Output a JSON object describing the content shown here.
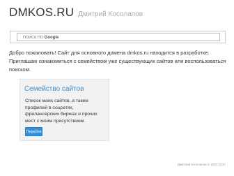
{
  "header": {
    "logo": "DMKOS.RU",
    "author": "Дмитрий Косолапов"
  },
  "search": {
    "placeholder": "Поиск: Google",
    "label_prefix": "ПОИСК ПО",
    "brand": "Google"
  },
  "intro": {
    "text": "Добро пожаловать! Сайт для основного домена dmkos.ru находится в разработке. Приглашаю ознакомиться с семейством уже существующих сайтов или воспользоваться поиском."
  },
  "card": {
    "title": "Семейство сайтов",
    "text": "Список моих сайтов, а также профилей в соцсетях, фрилансерских биржах и прочих мест с моим присутствием.",
    "button_label": "Перейти"
  },
  "footer": {
    "copyright": "Дмитрий Косолапов © 2007-2017"
  },
  "colors": {
    "accent": "#3a8fd0",
    "button": "#3b8ed1"
  },
  "icons": {
    "search": "search-icon"
  }
}
